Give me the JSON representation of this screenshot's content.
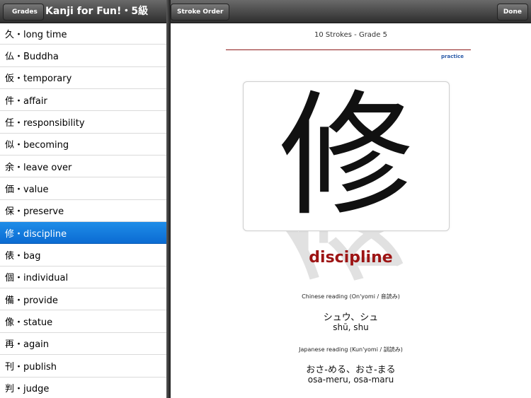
{
  "left_panel": {
    "back_label": "Grades",
    "title": "Kanji for Fun!・5級",
    "items": [
      {
        "label": "久・long time"
      },
      {
        "label": "仏・Buddha"
      },
      {
        "label": "仮・temporary"
      },
      {
        "label": "件・affair"
      },
      {
        "label": "任・responsibility"
      },
      {
        "label": "似・becoming"
      },
      {
        "label": "余・leave over"
      },
      {
        "label": "価・value"
      },
      {
        "label": "保・preserve"
      },
      {
        "label": "修・discipline",
        "selected": true
      },
      {
        "label": "俵・bag"
      },
      {
        "label": "個・individual"
      },
      {
        "label": "備・provide"
      },
      {
        "label": "像・statue"
      },
      {
        "label": "再・again"
      },
      {
        "label": "刊・publish"
      },
      {
        "label": "判・judge"
      }
    ]
  },
  "detail": {
    "stroke_order_label": "Stroke Order",
    "done_label": "Done",
    "strokes_info": "10 Strokes - Grade 5",
    "practice_link": "practice",
    "kanji": "修",
    "meaning": "discipline",
    "onyomi_label": "Chinese reading (On'yomi / 音読み)",
    "onyomi_kana": "シュウ、シュ",
    "onyomi_romaji": "shū, shu",
    "kunyomi_label": "Japanese reading (Kun'yomi / 訓読み)",
    "kunyomi_kana": "おさ-める、おさ-まる",
    "kunyomi_romaji": "osa-meru, osa-maru"
  },
  "colors": {
    "selection": "#0b6bd2",
    "meaning": "#9d1414",
    "rule": "#8e1a1a",
    "link": "#2a5aa8"
  }
}
